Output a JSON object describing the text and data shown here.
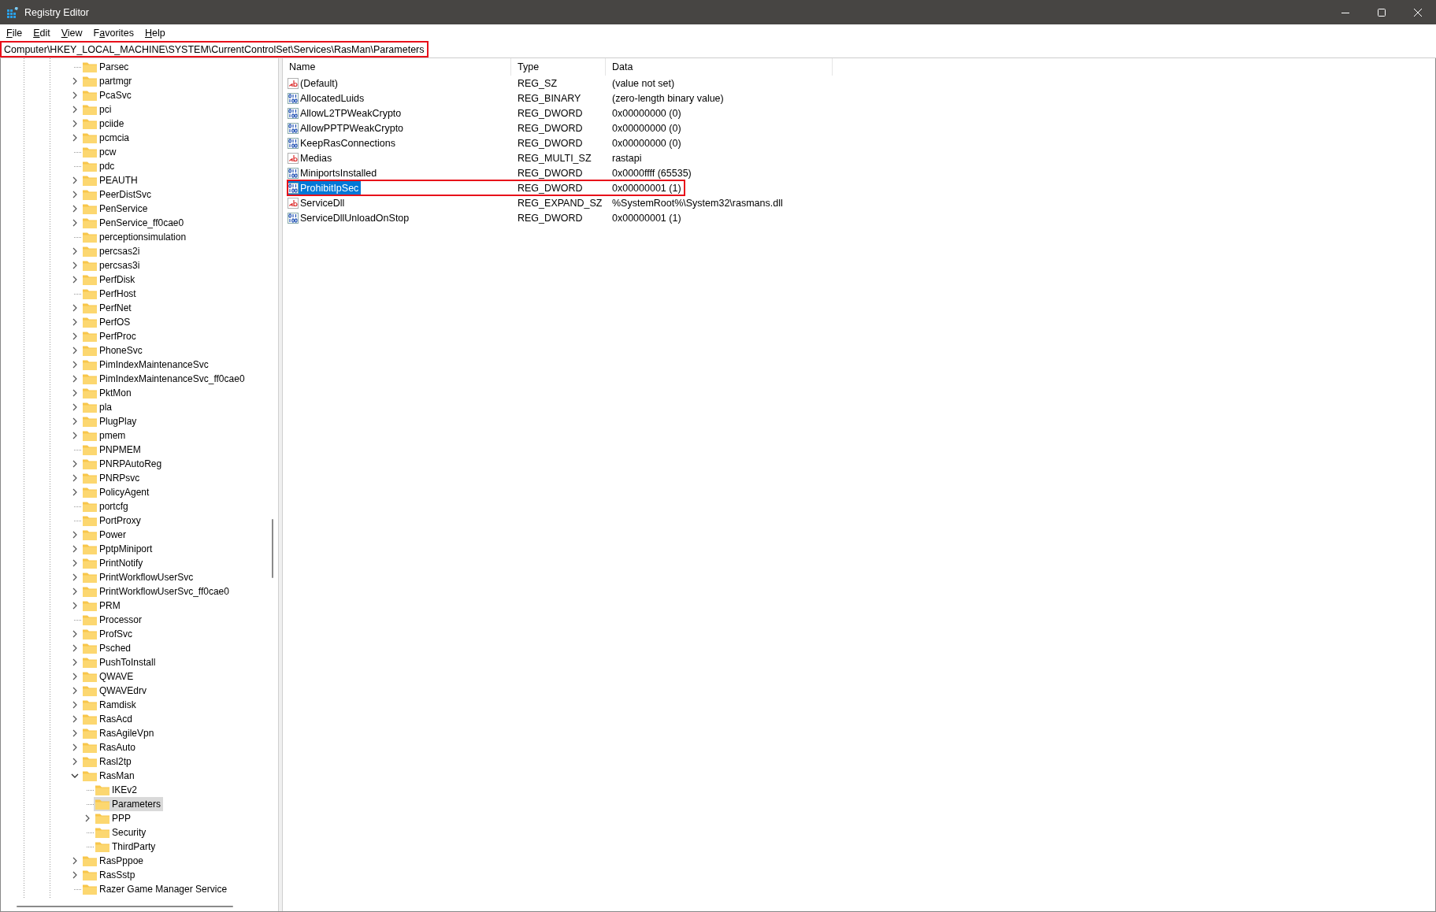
{
  "window": {
    "title": "Registry Editor"
  },
  "menu": [
    {
      "key": "F",
      "after": "ile"
    },
    {
      "key": "E",
      "after": "dit"
    },
    {
      "key": "V",
      "after": "iew"
    },
    {
      "before": "F",
      "key": "a",
      "after": "vorites"
    },
    {
      "key": "H",
      "after": "elp"
    }
  ],
  "address_bar": {
    "path": "Computer\\HKEY_LOCAL_MACHINE\\SYSTEM\\CurrentControlSet\\Services\\RasMan\\Parameters",
    "highlighted": true
  },
  "tree": {
    "items": [
      {
        "label": "Parsec",
        "kind": "leaf",
        "selected": false
      },
      {
        "label": "partmgr",
        "kind": "node",
        "expanded": false,
        "selected": false
      },
      {
        "label": "PcaSvc",
        "kind": "node",
        "expanded": false,
        "selected": false
      },
      {
        "label": "pci",
        "kind": "node",
        "expanded": false,
        "selected": false
      },
      {
        "label": "pciide",
        "kind": "node",
        "expanded": false,
        "selected": false
      },
      {
        "label": "pcmcia",
        "kind": "node",
        "expanded": false,
        "selected": false
      },
      {
        "label": "pcw",
        "kind": "leaf",
        "selected": false
      },
      {
        "label": "pdc",
        "kind": "leaf",
        "selected": false
      },
      {
        "label": "PEAUTH",
        "kind": "node",
        "expanded": false,
        "selected": false
      },
      {
        "label": "PeerDistSvc",
        "kind": "node",
        "expanded": false,
        "selected": false
      },
      {
        "label": "PenService",
        "kind": "node",
        "expanded": false,
        "selected": false
      },
      {
        "label": "PenService_ff0cae0",
        "kind": "node",
        "expanded": false,
        "selected": false
      },
      {
        "label": "perceptionsimulation",
        "kind": "leaf",
        "selected": false
      },
      {
        "label": "percsas2i",
        "kind": "node",
        "expanded": false,
        "selected": false
      },
      {
        "label": "percsas3i",
        "kind": "node",
        "expanded": false,
        "selected": false
      },
      {
        "label": "PerfDisk",
        "kind": "node",
        "expanded": false,
        "selected": false
      },
      {
        "label": "PerfHost",
        "kind": "leaf",
        "selected": false
      },
      {
        "label": "PerfNet",
        "kind": "node",
        "expanded": false,
        "selected": false
      },
      {
        "label": "PerfOS",
        "kind": "node",
        "expanded": false,
        "selected": false
      },
      {
        "label": "PerfProc",
        "kind": "node",
        "expanded": false,
        "selected": false
      },
      {
        "label": "PhoneSvc",
        "kind": "node",
        "expanded": false,
        "selected": false
      },
      {
        "label": "PimIndexMaintenanceSvc",
        "kind": "node",
        "expanded": false,
        "selected": false
      },
      {
        "label": "PimIndexMaintenanceSvc_ff0cae0",
        "kind": "node",
        "expanded": false,
        "selected": false
      },
      {
        "label": "PktMon",
        "kind": "node",
        "expanded": false,
        "selected": false
      },
      {
        "label": "pla",
        "kind": "node",
        "expanded": false,
        "selected": false
      },
      {
        "label": "PlugPlay",
        "kind": "node",
        "expanded": false,
        "selected": false
      },
      {
        "label": "pmem",
        "kind": "node",
        "expanded": false,
        "selected": false
      },
      {
        "label": "PNPMEM",
        "kind": "leaf",
        "selected": false
      },
      {
        "label": "PNRPAutoReg",
        "kind": "node",
        "expanded": false,
        "selected": false
      },
      {
        "label": "PNRPsvc",
        "kind": "node",
        "expanded": false,
        "selected": false
      },
      {
        "label": "PolicyAgent",
        "kind": "node",
        "expanded": false,
        "selected": false
      },
      {
        "label": "portcfg",
        "kind": "leaf",
        "selected": false
      },
      {
        "label": "PortProxy",
        "kind": "leaf",
        "selected": false
      },
      {
        "label": "Power",
        "kind": "node",
        "expanded": false,
        "selected": false
      },
      {
        "label": "PptpMiniport",
        "kind": "node",
        "expanded": false,
        "selected": false
      },
      {
        "label": "PrintNotify",
        "kind": "node",
        "expanded": false,
        "selected": false
      },
      {
        "label": "PrintWorkflowUserSvc",
        "kind": "node",
        "expanded": false,
        "selected": false
      },
      {
        "label": "PrintWorkflowUserSvc_ff0cae0",
        "kind": "node",
        "expanded": false,
        "selected": false
      },
      {
        "label": "PRM",
        "kind": "node",
        "expanded": false,
        "selected": false
      },
      {
        "label": "Processor",
        "kind": "leaf",
        "selected": false
      },
      {
        "label": "ProfSvc",
        "kind": "node",
        "expanded": false,
        "selected": false
      },
      {
        "label": "Psched",
        "kind": "node",
        "expanded": false,
        "selected": false
      },
      {
        "label": "PushToInstall",
        "kind": "node",
        "expanded": false,
        "selected": false
      },
      {
        "label": "QWAVE",
        "kind": "node",
        "expanded": false,
        "selected": false
      },
      {
        "label": "QWAVEdrv",
        "kind": "node",
        "expanded": false,
        "selected": false
      },
      {
        "label": "Ramdisk",
        "kind": "node",
        "expanded": false,
        "selected": false
      },
      {
        "label": "RasAcd",
        "kind": "node",
        "expanded": false,
        "selected": false
      },
      {
        "label": "RasAgileVpn",
        "kind": "node",
        "expanded": false,
        "selected": false
      },
      {
        "label": "RasAuto",
        "kind": "node",
        "expanded": false,
        "selected": false
      },
      {
        "label": "Rasl2tp",
        "kind": "node",
        "expanded": false,
        "selected": false
      },
      {
        "label": "RasMan",
        "kind": "node",
        "expanded": true,
        "selected": false,
        "children": [
          {
            "label": "IKEv2",
            "kind": "leaf",
            "selected": false
          },
          {
            "label": "Parameters",
            "kind": "leaf",
            "selected": true
          },
          {
            "label": "PPP",
            "kind": "node",
            "expanded": false,
            "selected": false
          },
          {
            "label": "Security",
            "kind": "leaf",
            "selected": false
          },
          {
            "label": "ThirdParty",
            "kind": "leaf",
            "selected": false
          }
        ]
      },
      {
        "label": "RasPppoe",
        "kind": "node",
        "expanded": false,
        "selected": false
      },
      {
        "label": "RasSstp",
        "kind": "node",
        "expanded": false,
        "selected": false
      },
      {
        "label": "Razer Game Manager Service",
        "kind": "leaf",
        "selected": false
      }
    ]
  },
  "values": {
    "columns": [
      "Name",
      "Type",
      "Data"
    ],
    "rows": [
      {
        "name": "(Default)",
        "type": "REG_SZ",
        "data": "(value not set)",
        "kind": "string",
        "selected": false,
        "highlighted": false
      },
      {
        "name": "AllocatedLuids",
        "type": "REG_BINARY",
        "data": "(zero-length binary value)",
        "kind": "binary",
        "selected": false,
        "highlighted": false
      },
      {
        "name": "AllowL2TPWeakCrypto",
        "type": "REG_DWORD",
        "data": "0x00000000 (0)",
        "kind": "binary",
        "selected": false,
        "highlighted": false
      },
      {
        "name": "AllowPPTPWeakCrypto",
        "type": "REG_DWORD",
        "data": "0x00000000 (0)",
        "kind": "binary",
        "selected": false,
        "highlighted": false
      },
      {
        "name": "KeepRasConnections",
        "type": "REG_DWORD",
        "data": "0x00000000 (0)",
        "kind": "binary",
        "selected": false,
        "highlighted": false
      },
      {
        "name": "Medias",
        "type": "REG_MULTI_SZ",
        "data": "rastapi",
        "kind": "string",
        "selected": false,
        "highlighted": false
      },
      {
        "name": "MiniportsInstalled",
        "type": "REG_DWORD",
        "data": "0x0000ffff (65535)",
        "kind": "binary",
        "selected": false,
        "highlighted": false
      },
      {
        "name": "ProhibitIpSec",
        "type": "REG_DWORD",
        "data": "0x00000001 (1)",
        "kind": "binary",
        "selected": true,
        "highlighted": true
      },
      {
        "name": "ServiceDll",
        "type": "REG_EXPAND_SZ",
        "data": "%SystemRoot%\\System32\\rasmans.dll",
        "kind": "string",
        "selected": false,
        "highlighted": false
      },
      {
        "name": "ServiceDllUnloadOnStop",
        "type": "REG_DWORD",
        "data": "0x00000001 (1)",
        "kind": "binary",
        "selected": false,
        "highlighted": false
      }
    ]
  }
}
